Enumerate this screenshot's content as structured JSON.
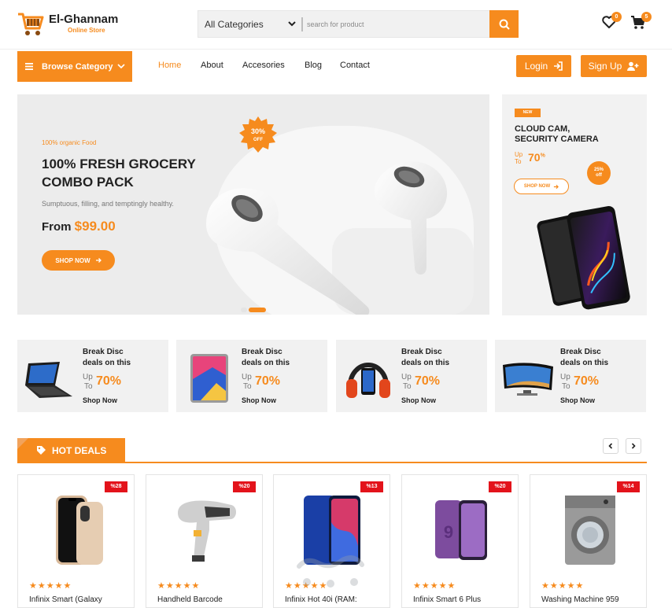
{
  "brand": {
    "name": "El-Ghannam",
    "tagline": "Online Store"
  },
  "search": {
    "category": "All Categories",
    "placeholder": "search for product"
  },
  "header": {
    "wishlist_count": "0",
    "cart_count": "5"
  },
  "nav": {
    "browse_label": "Browse Category",
    "links": [
      {
        "label": "Home",
        "active": true
      },
      {
        "label": "About"
      },
      {
        "label": "Accesories"
      },
      {
        "label": "Blog"
      },
      {
        "label": "Contact"
      }
    ],
    "login_label": "Login",
    "signup_label": "Sign Up"
  },
  "hero": {
    "subtitle": "100% organic Food",
    "title_line1": "100% FRESH GROCERY",
    "title_line2": "COMBO PACK",
    "description": "Sumptuous, filling, and temptingly healthy.",
    "price_prefix": "From",
    "price": "$99.00",
    "button": "SHOP NOW",
    "seal_pct": "30%",
    "seal_off": "OFF",
    "active_slide": 2,
    "slide_count": 2
  },
  "side_banner": {
    "badge": "NEW",
    "title_line1": "CLOUD CAM,",
    "title_line2": "SECURITY CAMERA",
    "up": "Up",
    "to": "To",
    "pct": "70",
    "pct_sign": "%",
    "button": "SHOP NOW",
    "seal_pct": "25%",
    "seal_off": "off"
  },
  "promos": [
    {
      "title_line1": "Break Disc",
      "title_line2": "deals on this",
      "up": "Up",
      "to": "To",
      "pct": "70%",
      "shop": "Shop Now",
      "icon": "laptop-icon"
    },
    {
      "title_line1": "Break Disc",
      "title_line2": "deals on this",
      "up": "Up",
      "to": "To",
      "pct": "70%",
      "shop": "Shop Now",
      "icon": "tablet-icon"
    },
    {
      "title_line1": "Break Disc",
      "title_line2": "deals on this",
      "up": "Up",
      "to": "To",
      "pct": "70%",
      "shop": "Shop Now",
      "icon": "headphones-icon"
    },
    {
      "title_line1": "Break Disc",
      "title_line2": "deals on this",
      "up": "Up",
      "to": "To",
      "pct": "70%",
      "shop": "Shop Now",
      "icon": "tv-icon"
    }
  ],
  "hot_deals": {
    "title": "HOT DEALS",
    "products": [
      {
        "discount": "%28",
        "stars": "★★★★★",
        "name": "Infinix Smart (Galaxy",
        "icon": "iphone-icon"
      },
      {
        "discount": "%20",
        "stars": "★★★★★",
        "name": "Handheld Barcode",
        "icon": "barcode-scanner-icon"
      },
      {
        "discount": "%13",
        "stars": "★★★★★",
        "name": "Infinix Hot 40i (RAM:",
        "icon": "smartphone-icon"
      },
      {
        "discount": "%20",
        "stars": "★★★★★",
        "name": "Infinix Smart 6 Plus",
        "icon": "galaxy-phone-icon"
      },
      {
        "discount": "%14",
        "stars": "★★★★★",
        "name": "Washing Machine 959",
        "icon": "washing-machine-icon"
      }
    ]
  },
  "colors": {
    "accent": "#f68b1e",
    "discount": "#e3131b",
    "panel": "#f1f1f1"
  }
}
